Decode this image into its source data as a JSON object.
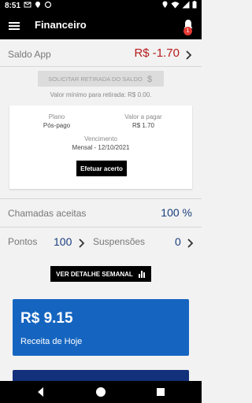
{
  "status_bar": {
    "time": "8:51"
  },
  "app_bar": {
    "title": "Financeiro",
    "notification_count": "1"
  },
  "saldo": {
    "label": "Saldo App",
    "value": "R$ -1.70"
  },
  "withdraw": {
    "button_label": "SOLICITAR RETIRADA DO SALDO",
    "minimum_text": "Valor mínimo para retirada: R$ 0.00."
  },
  "plan_card": {
    "plano_label": "Plano",
    "plano_value": "Pós-pago",
    "valor_label": "Valor a pagar",
    "valor_value": "R$ 1.70",
    "vencimento_label": "Vencimento",
    "vencimento_value": "Mensal - 12/10/2021",
    "button_label": "Efetuar acerto"
  },
  "calls": {
    "label": "Chamadas aceitas",
    "value": "100 %"
  },
  "stats": {
    "pontos_label": "Pontos",
    "pontos_value": "100",
    "suspensoes_label": "Suspensões",
    "suspensoes_value": "0"
  },
  "weekly_button": {
    "label": "VER DETALHE SEMANAL"
  },
  "revenue": {
    "value": "R$ 9.15",
    "label": "Receita de Hoje"
  },
  "colors": {
    "negative": "#b71c1c",
    "accent_blue": "#1565c0",
    "number_blue": "#1a3d7c"
  }
}
